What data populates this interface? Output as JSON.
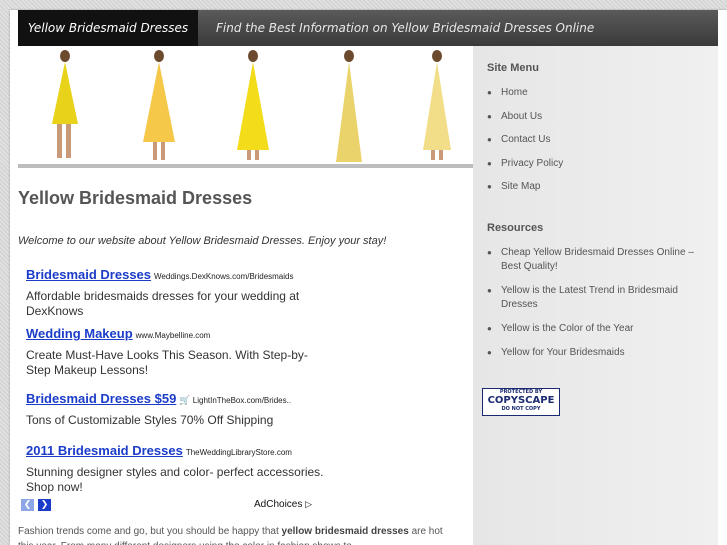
{
  "header": {
    "site_title": "Yellow Bridesmaid Dresses",
    "tagline": "Find the Best Information on Yellow Bridesmaid Dresses Online"
  },
  "banner": {
    "dresses": [
      "yellow-dress-1",
      "yellow-dress-2",
      "yellow-dress-3",
      "yellow-dress-4",
      "yellow-dress-5"
    ]
  },
  "main": {
    "title": "Yellow Bridesmaid Dresses",
    "welcome": "Welcome to our website about Yellow Bridesmaid Dresses. Enjoy your stay!",
    "ads": [
      {
        "title": "Bridesmaid Dresses",
        "url": "Weddings.DexKnows.com/Bridesmaids",
        "desc": "Affordable bridesmaids dresses for your wedding at DexKnows"
      },
      {
        "title": "Wedding Makeup",
        "url": "www.Maybelline.com",
        "desc": "Create Must-Have Looks This Season. With Step-by-Step Makeup Lessons!"
      },
      {
        "title": "Bridesmaid Dresses $59",
        "url": "LightInTheBox.com/Brides..",
        "desc": "Tons of Customizable Styles 70% Off Shipping"
      },
      {
        "title": "2011 Bridesmaid Dresses",
        "url": "TheWeddingLibraryStore.com",
        "desc": "Stunning designer styles and color- perfect accessories. Shop now!"
      }
    ],
    "adchoices": "AdChoices",
    "prev_glyph": "❮",
    "next_glyph": "❯",
    "body_before": "Fashion trends come and go, but you should be happy that ",
    "body_bold": "yellow bridesmaid dresses",
    "body_after": " are hot this year. From many different designers using the color in fashion shows to"
  },
  "sidebar": {
    "menu_heading": "Site Menu",
    "menu": [
      "Home",
      "About Us",
      "Contact Us",
      "Privacy Policy",
      "Site Map"
    ],
    "resources_heading": "Resources",
    "resources": [
      "Cheap Yellow Bridesmaid Dresses Online – Best Quality!",
      "Yellow is the Latest Trend in Bridesmaid Dresses",
      "Yellow is the Color of the Year",
      "Yellow for Your Bridesmaids"
    ],
    "copyscape": {
      "line1": "PROTECTED BY",
      "line2": "COPYSCAPE",
      "line3": "DO NOT COPY"
    }
  },
  "colors": {
    "link": "#1a3cc8",
    "header_dark": "#111111",
    "dress_yellow": "#f2d21c"
  }
}
